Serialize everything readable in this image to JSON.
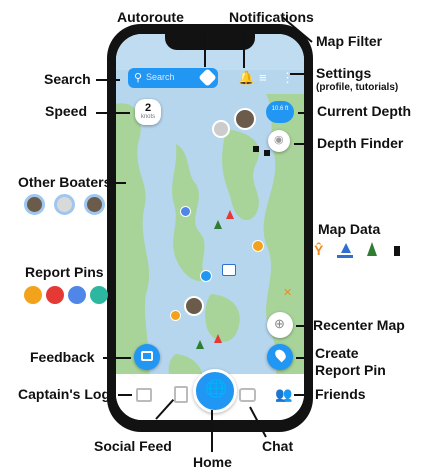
{
  "labels": {
    "autoroute": "Autoroute",
    "notifications": "Notifications",
    "map_filter": "Map Filter",
    "search": "Search",
    "settings": "Settings",
    "settings_sub": "(profile, tutorials)",
    "speed": "Speed",
    "current_depth": "Current Depth",
    "depth_finder": "Depth Finder",
    "other_boaters": "Other Boaters",
    "map_data": "Map Data",
    "report_pins": "Report Pins",
    "recenter_map": "Recenter Map",
    "create_report_pin": "Create\nReport Pin",
    "feedback": "Feedback",
    "captains_log": "Captain's Log",
    "friends": "Friends",
    "social_feed": "Social Feed",
    "chat": "Chat",
    "home": "Home"
  },
  "app": {
    "search_placeholder": "Search",
    "speed_value": "2",
    "speed_unit": "knots",
    "depth_value": "10.6 ft",
    "accent_color": "#2196f3"
  },
  "colors": {
    "report_pin_1": "#f2a31b",
    "report_pin_2": "#e53935",
    "report_pin_3": "#4f86e8",
    "report_pin_4": "#2eb7a0",
    "map_data_1": "#f08a1c",
    "map_data_2": "#2f6fd0",
    "map_data_3": "#2e7d32",
    "map_data_4": "#111111",
    "water": "#b6d6ee",
    "land": "#a8d49a"
  }
}
